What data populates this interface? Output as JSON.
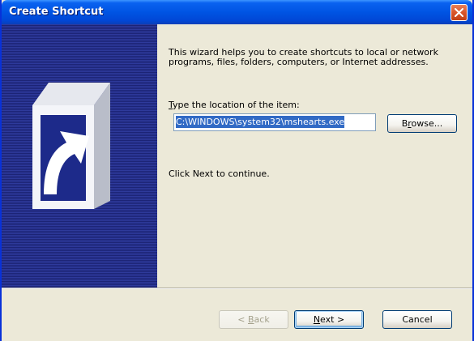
{
  "window": {
    "title": "Create Shortcut"
  },
  "content": {
    "intro": "This wizard helps you to create shortcuts to local or network programs, files, folders, computers, or Internet addresses.",
    "location_label_key": "T",
    "location_label_rest": "ype the location of the item:",
    "location_value": "C:\\WINDOWS\\system32\\mshearts.exe",
    "browse_key": "r",
    "browse_pre": "B",
    "browse_post": "owse...",
    "hint": "Click Next to continue."
  },
  "buttons": {
    "back_pre": "< ",
    "back_key": "B",
    "back_post": "ack",
    "next_key": "N",
    "next_post": "ext >",
    "cancel": "Cancel"
  },
  "colors": {
    "titlebar": "#0054e3",
    "banner": "#222b86",
    "selection": "#316ac5",
    "dialog_bg": "#ece9d8"
  },
  "icons": {
    "close": "close-icon",
    "shortcut": "shortcut-arrow-icon"
  }
}
